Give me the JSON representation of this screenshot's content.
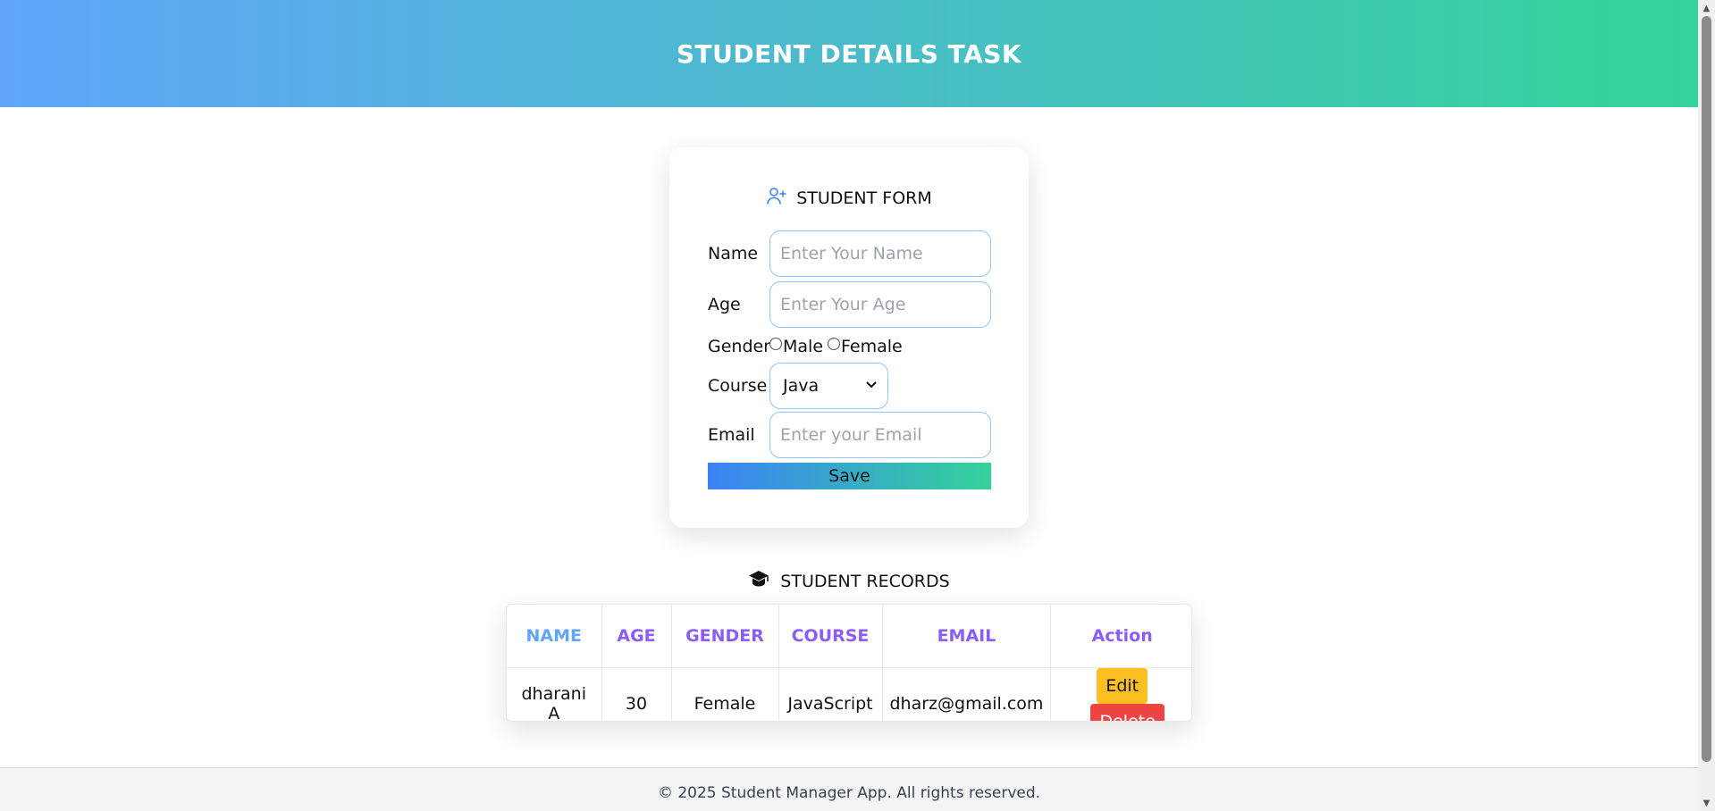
{
  "header": {
    "title": "STUDENT DETAILS TASK"
  },
  "form": {
    "title": "STUDENT FORM",
    "title_icon": "user-plus-icon",
    "name_label": "Name",
    "name_placeholder": "Enter Your Name",
    "age_label": "Age",
    "age_placeholder": "Enter Your Age",
    "gender_label": "Gender",
    "gender_options": [
      "Male",
      "Female"
    ],
    "course_label": "Course",
    "course_selected": "Java",
    "email_label": "Email",
    "email_placeholder": "Enter your Email",
    "save_label": "Save"
  },
  "records": {
    "title": "STUDENT RECORDS",
    "title_icon": "graduation-cap-icon",
    "columns": [
      "NAME",
      "AGE",
      "GENDER",
      "COURSE",
      "EMAIL",
      "Action"
    ],
    "rows": [
      {
        "name": "dharani A",
        "age": "30",
        "gender": "Female",
        "course": "JavaScript",
        "email": "dharz@gmail.com"
      }
    ],
    "edit_label": "Edit",
    "delete_label": "Delete"
  },
  "footer": {
    "text": "© 2025 Student Manager App. All rights reserved."
  },
  "colors": {
    "header_gradient": [
      "#60a5fa",
      "#34d399"
    ],
    "save_gradient": [
      "#3b82f6",
      "#34d399"
    ],
    "edit": "#fbbf24",
    "delete": "#ef4444",
    "column_header": "#8b5cf6"
  }
}
